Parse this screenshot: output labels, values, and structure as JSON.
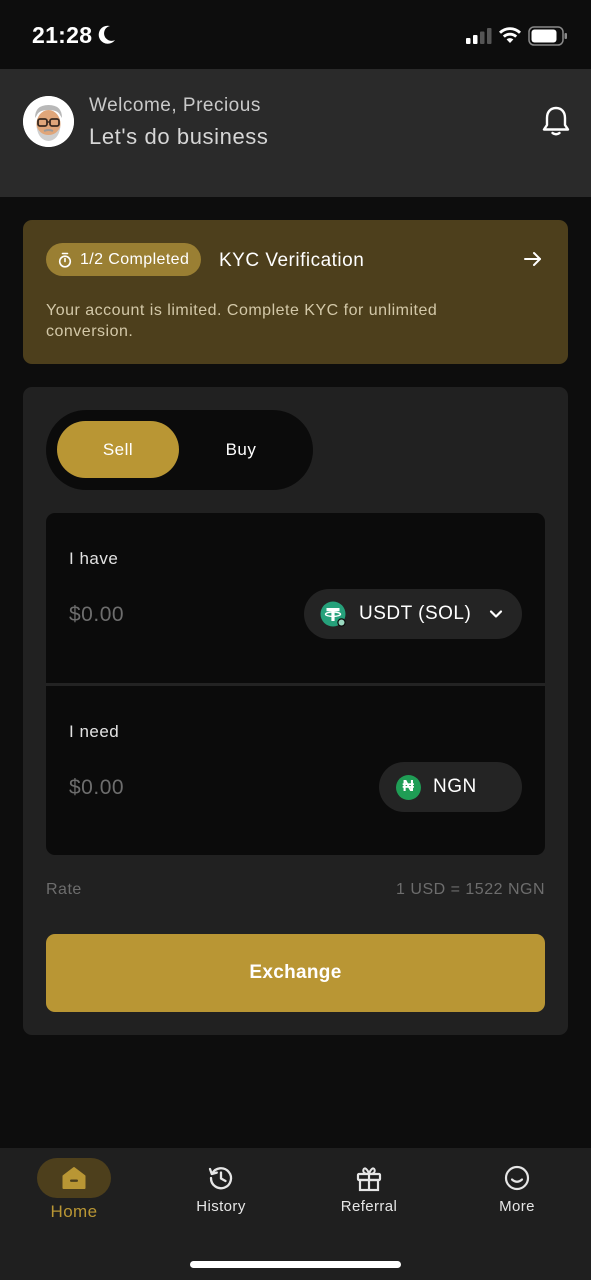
{
  "status_bar": {
    "time": "21:28"
  },
  "header": {
    "welcome": "Welcome, Precious",
    "tagline": "Let's do business"
  },
  "kyc": {
    "progress": "1/2 Completed",
    "title": "KYC Verification",
    "description": "Your account is limited. Complete KYC for unlimited conversion."
  },
  "trade": {
    "tabs": {
      "sell": "Sell",
      "buy": "Buy",
      "active": "Sell"
    },
    "have": {
      "label": "I have",
      "amount": "$0.00",
      "currency": "USDT (SOL)"
    },
    "need": {
      "label": "I need",
      "amount": "$0.00",
      "currency": "NGN",
      "currency_symbol": "₦"
    },
    "rate_label": "Rate",
    "rate_value": "1 USD = 1522 NGN",
    "exchange_label": "Exchange"
  },
  "tabbar": {
    "items": [
      {
        "label": "Home",
        "icon": "home-icon",
        "active": true
      },
      {
        "label": "History",
        "icon": "history-icon",
        "active": false
      },
      {
        "label": "Referral",
        "icon": "gift-icon",
        "active": false
      },
      {
        "label": "More",
        "icon": "smile-icon",
        "active": false
      }
    ]
  },
  "colors": {
    "accent": "#b99634",
    "kyc_bg": "#4d3f1c",
    "card_bg": "#212121",
    "header_bg": "#2a2a2a",
    "tether_green": "#26a17b",
    "naira_green": "#1f9d55"
  }
}
